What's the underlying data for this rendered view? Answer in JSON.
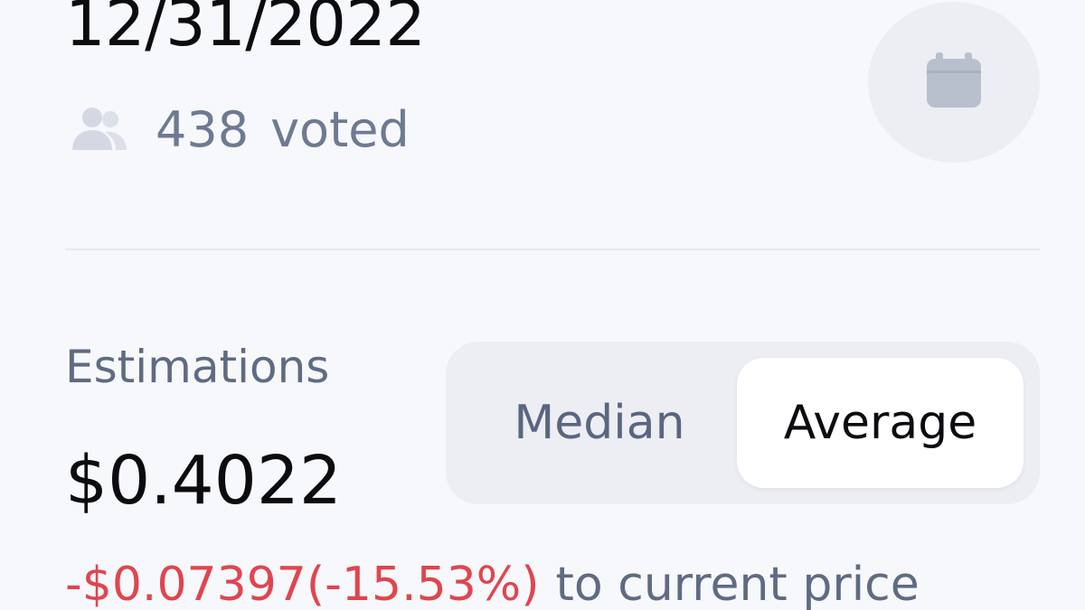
{
  "header": {
    "date": "12/31/2022",
    "voted_count": "438",
    "voted_label": "voted"
  },
  "icons": {
    "users": "users-icon",
    "calendar": "calendar-icon"
  },
  "estimations": {
    "label": "Estimations",
    "value": "$0.4022",
    "diff_amount": "-$0.07397(-15.53%)",
    "diff_suffix": "to current price"
  },
  "toggle": {
    "options": [
      {
        "label": "Median",
        "selected": false
      },
      {
        "label": "Average",
        "selected": true
      }
    ]
  },
  "colors": {
    "background": "#f7f8fb",
    "muted_text": "#5f6b82",
    "negative": "#e0454f",
    "toggle_track": "#eceef3",
    "toggle_selected": "#ffffff"
  }
}
